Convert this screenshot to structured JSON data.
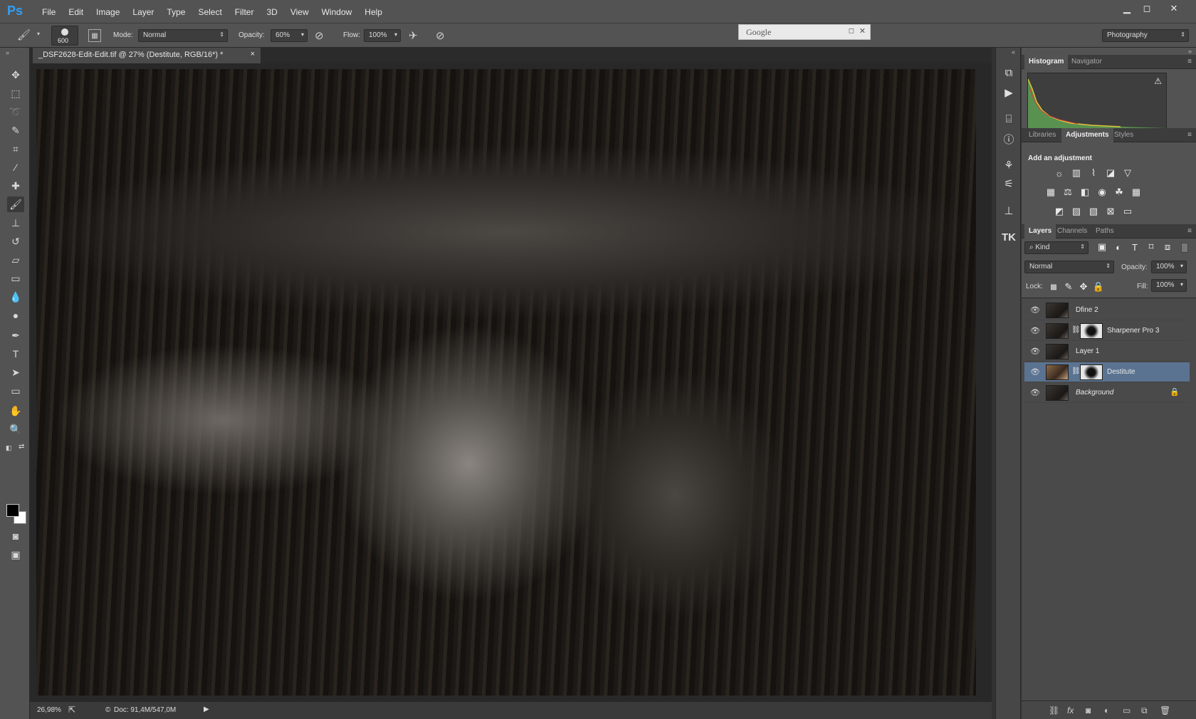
{
  "app": {
    "logo": "Ps"
  },
  "menubar": {
    "items": [
      "File",
      "Edit",
      "Image",
      "Layer",
      "Type",
      "Select",
      "Filter",
      "3D",
      "View",
      "Window",
      "Help"
    ]
  },
  "window_controls": {
    "minimize": "▁",
    "restore": "◻",
    "close": "✕"
  },
  "options_bar": {
    "brush_size": "600",
    "mode_label": "Mode:",
    "mode_value": "Normal",
    "opacity_label": "Opacity:",
    "opacity_value": "60%",
    "flow_label": "Flow:",
    "flow_value": "100%",
    "workspace_value": "Photography"
  },
  "google_window": {
    "title": "Google"
  },
  "document": {
    "tab_title": "_DSF2628-Edit-Edit.tif @ 27% (Destitute, RGB/16*) *",
    "tab_close": "×"
  },
  "statusbar": {
    "zoom": "26,98%",
    "doc_info": "Doc: 91,4M/547,0M"
  },
  "histogram_panel": {
    "tabs": [
      "Histogram",
      "Navigator"
    ],
    "warning_icon": "warning-icon"
  },
  "adjustments_panel": {
    "tabs": [
      "Libraries",
      "Adjustments",
      "Styles"
    ],
    "heading": "Add an adjustment"
  },
  "layers_panel": {
    "tabs": [
      "Layers",
      "Channels",
      "Paths"
    ],
    "filter_kind": "Kind",
    "blend_mode": "Normal",
    "opacity_label": "Opacity:",
    "opacity_value": "100%",
    "lock_label": "Lock:",
    "fill_label": "Fill:",
    "fill_value": "100%",
    "layers": [
      {
        "name": "Dfine 2",
        "has_mask": false,
        "selected": false
      },
      {
        "name": "Sharpener Pro 3",
        "has_mask": true,
        "selected": false
      },
      {
        "name": "Layer 1",
        "has_mask": false,
        "selected": false
      },
      {
        "name": "Destitute",
        "has_mask": true,
        "selected": true
      },
      {
        "name": "Background",
        "has_mask": false,
        "selected": false,
        "locked": true
      }
    ]
  },
  "colors": {
    "accent_selection": "#5a7391",
    "ps_logo": "#2f9ff7"
  }
}
